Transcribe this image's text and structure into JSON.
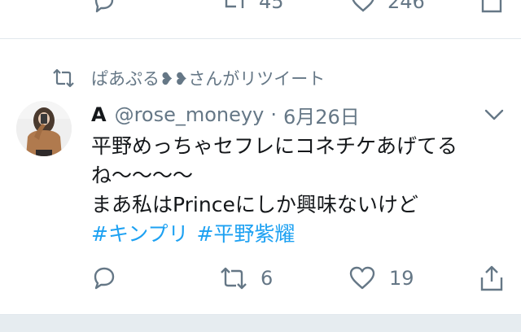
{
  "previous_tweet": {
    "retweet_count": "45",
    "like_count": "246"
  },
  "retweet_context": {
    "text": "ぱあぷる❥❥さんがリツイート"
  },
  "tweet": {
    "display_name": "A",
    "handle": "@rose_moneyy",
    "separator": "·",
    "date": "6月26日",
    "text_lines": [
      "平野めっちゃセフレにコネチケあげてる",
      "ね〜〜〜〜",
      "まあ私はPrinceにしか興味ないけど"
    ],
    "hashtags": [
      "#キンプリ",
      "#平野紫耀"
    ],
    "reply_count": "",
    "retweet_count": "6",
    "like_count": "19"
  },
  "colors": {
    "link_blue": "#1da1f2",
    "secondary_gray": "#657786",
    "divider": "#e1e8ed",
    "background_gray": "#e6ecf0"
  },
  "icons": [
    "reply-icon",
    "retweet-icon",
    "like-icon",
    "share-icon",
    "caret-down-icon"
  ]
}
